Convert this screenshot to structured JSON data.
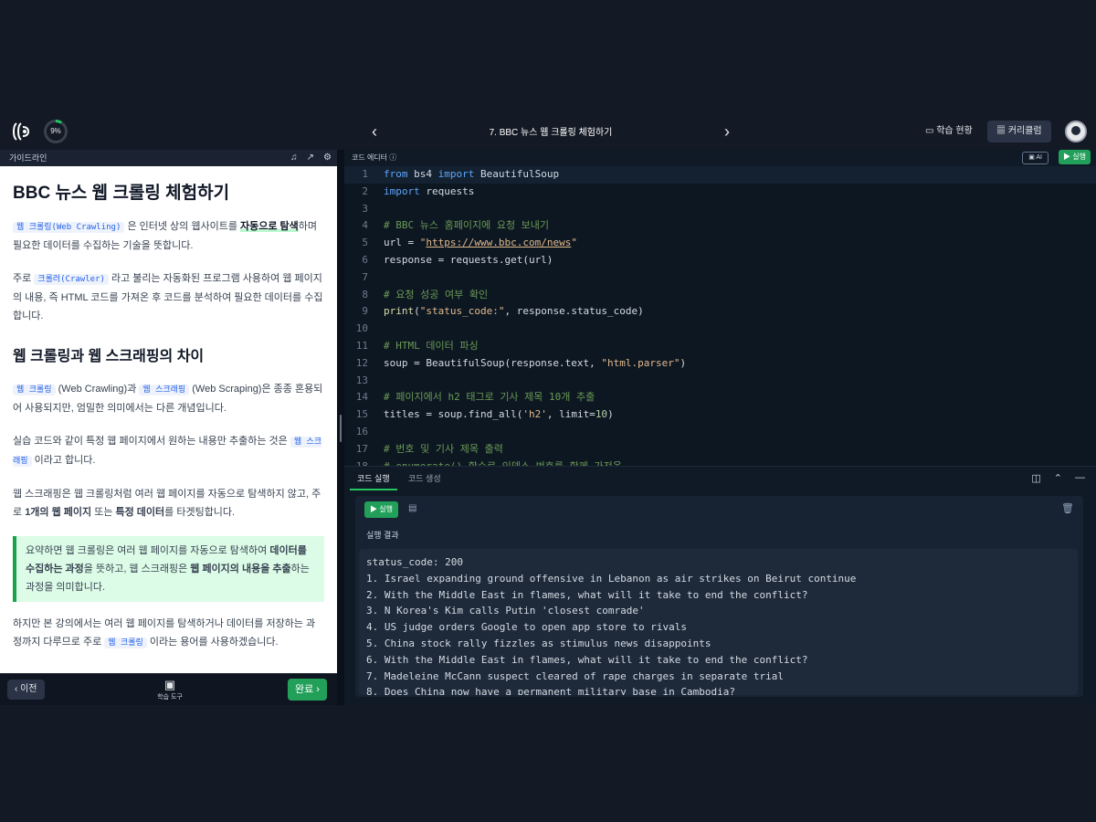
{
  "topbar": {
    "progress": "9%",
    "title": "7. BBC 뉴스 웹 크롤링 체험하기",
    "status_label": "학습 현황",
    "curriculum_label": "커리큘럼"
  },
  "guide": {
    "header": "가이드라인",
    "h1": "BBC 뉴스 웹 크롤링 체험하기",
    "p1": {
      "kw": "웹 크롤링(Web Crawling)",
      "a": " 은 인터넷 상의 웹사이트를 ",
      "hl": "자동으로 탐색",
      "b": "하며 필요한 데이터를 수집하는 기술을 뜻합니다."
    },
    "p2": {
      "a": "주로 ",
      "kw": "크롤러(Crawler)",
      "b": " 라고 불리는 자동화된 프로그램 사용하여 웹 페이지의 내용, 즉 HTML 코드를 가져온 후 코드를 분석하여 필요한 데이터를 수집합니다."
    },
    "h2": "웹 크롤링과 웹 스크래핑의 차이",
    "p3": {
      "kw1": "웹 크롤링",
      "a": " (Web Crawling)과 ",
      "kw2": "웹 스크래핑",
      "b": " (Web Scraping)은 종종 혼용되어 사용되지만, 엄밀한 의미에서는 다른 개념입니다."
    },
    "p4": {
      "a": "실습 코드와 같이 특정 웹 페이지에서 원하는 내용만 추출하는 것은 ",
      "kw": "웹 스크래핑",
      "b": " 이라고 합니다."
    },
    "p5": {
      "a": "웹 스크래핑은 웹 크롤링처럼 여러 웹 페이지를 자동으로 탐색하지 않고, 주로 ",
      "b1": "1개의 웹 페이지",
      "c": " 또는 ",
      "b2": "특정 데이터",
      "d": "를 타겟팅합니다."
    },
    "note": {
      "a": "요약하면 웹 크롤링은 여러 웹 페이지를 자동으로 탐색하여 ",
      "b1": "데이터를 수집하는 과정",
      "c": "을 뜻하고, 웹 스크래핑은 ",
      "b2": "웹 페이지의 내용을 추출",
      "d": "하는 과정을 의미합니다."
    },
    "p6": {
      "a": "하지만 본 강의에서는 여러 웹 페이지를 탐색하거나 데이터를 저장하는 과정까지 다루므로 주로 ",
      "kw": "웹 크롤링",
      "b": " 이라는 용어를 사용하겠습니다."
    }
  },
  "footer": {
    "prev": "이전",
    "tools": "학습 도구",
    "done": "완료"
  },
  "editor": {
    "header": "코드 에디터",
    "ai": "AI",
    "run": "실행"
  },
  "bottom": {
    "tab_run": "코드 실행",
    "tab_gen": "코드 생성",
    "run": "실행",
    "result_label": "실행 결과",
    "output": [
      "status_code: 200",
      "1. Israel expanding ground offensive in Lebanon as air strikes on Beirut continue",
      "2. With the Middle East in flames, what will it take to end the conflict?",
      "3. N Korea's Kim calls Putin 'closest comrade'",
      "4. US judge orders Google to open app store to rivals",
      "5. China stock rally fizzles as stimulus news disappoints",
      "6. With the Middle East in flames, what will it take to end the conflict?",
      "7. Madeleine McCann suspect cleared of rape charges in separate trial",
      "8. Does China now have a permanent military base in Cambodia?"
    ]
  }
}
